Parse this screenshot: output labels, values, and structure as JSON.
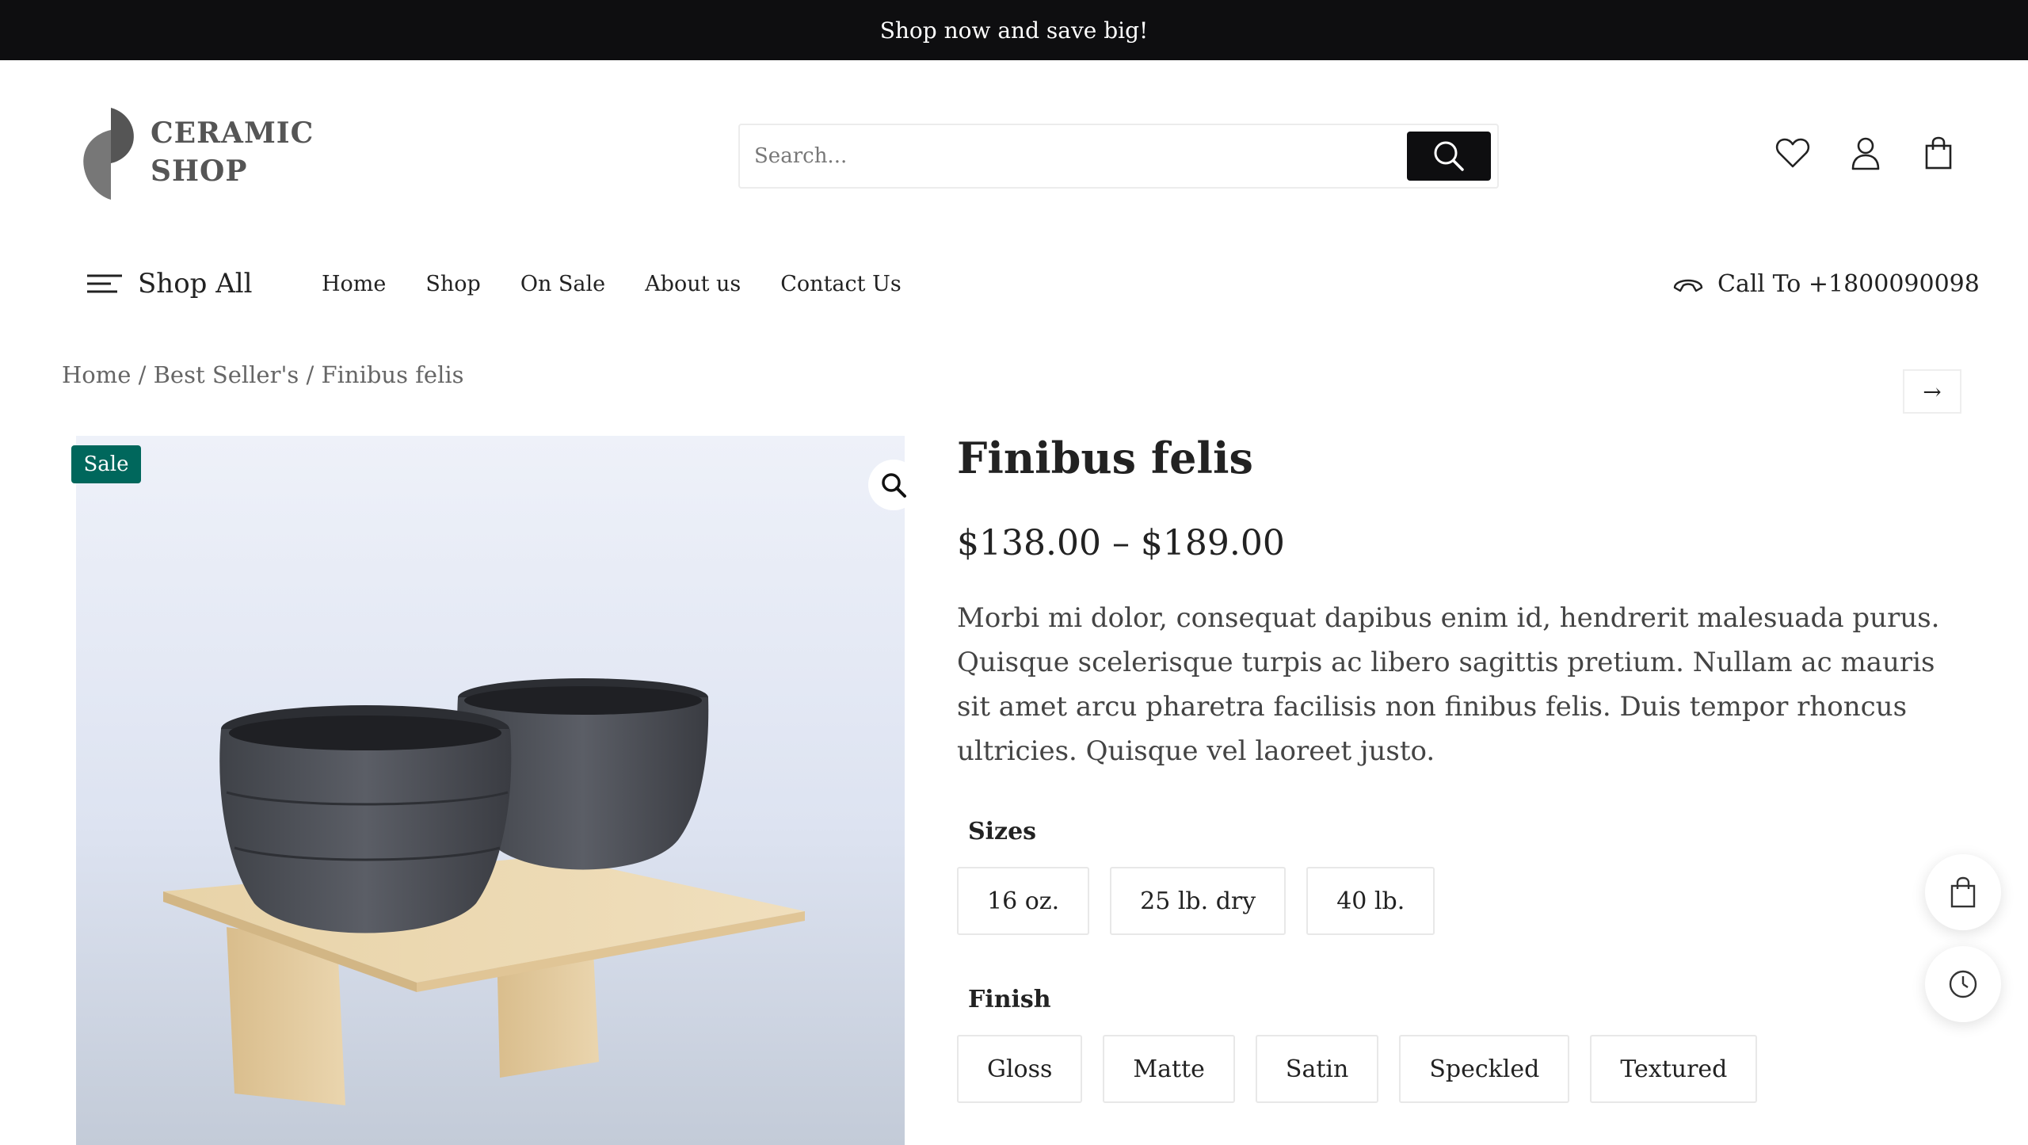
{
  "announcement": "Shop now and save big!",
  "logo": {
    "line1": "CERAMIC",
    "line2": "SHOP"
  },
  "search": {
    "placeholder": "Search..."
  },
  "nav": {
    "shop_all": "Shop All",
    "links": [
      "Home",
      "Shop",
      "On Sale",
      "About us",
      "Contact Us"
    ],
    "call": "Call To +1800090098"
  },
  "breadcrumb": "Home / Best Seller's / Finibus felis",
  "product": {
    "badge": "Sale",
    "title": "Finibus felis",
    "price": "$138.00 – $189.00",
    "description": "Morbi mi dolor, consequat dapibus enim id, hendrerit malesuada purus. Quisque scelerisque turpis ac libero sagittis pretium. Nullam ac mauris sit amet arcu pharetra facilisis non finibus felis. Duis tempor rhoncus ultricies. Quisque vel laoreet justo.",
    "sizes_label": "Sizes",
    "sizes": [
      "16 oz.",
      "25 lb. dry",
      "40 lb."
    ],
    "finish_label": "Finish",
    "finishes": [
      "Gloss",
      "Matte",
      "Satin",
      "Speckled",
      "Textured"
    ]
  },
  "icons": {
    "search_button": "search-icon",
    "wishlist": "heart-icon",
    "account": "user-icon",
    "cart": "shopping-bag-icon",
    "menu": "menu-lines-icon",
    "phone": "phone-icon",
    "next": "arrow-right-icon",
    "zoom": "magnifier-icon",
    "floating_cart": "shopping-bag-icon",
    "floating_history": "clock-icon"
  },
  "colors": {
    "topbar": "#0e0e10",
    "sale_badge": "#00675c",
    "text": "#222222",
    "muted": "#666666"
  }
}
